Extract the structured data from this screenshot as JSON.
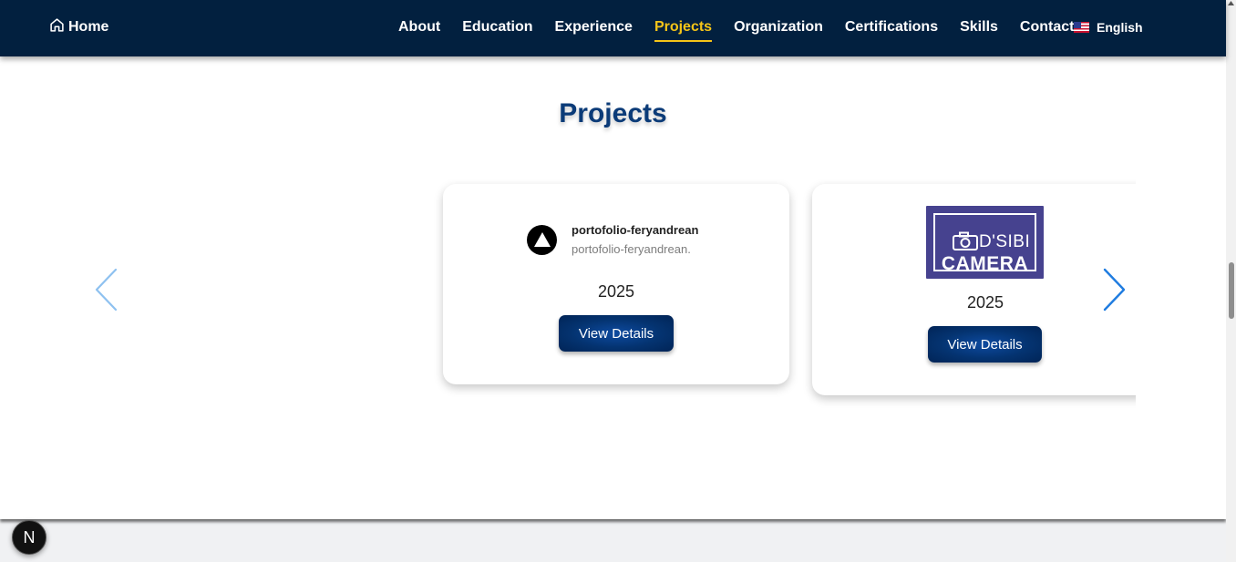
{
  "nav": {
    "home_label": "Home",
    "home_icon": "home-icon",
    "items": [
      {
        "label": "About"
      },
      {
        "label": "Education"
      },
      {
        "label": "Experience"
      },
      {
        "label": "Projects",
        "active": true
      },
      {
        "label": "Organization"
      },
      {
        "label": "Certifications"
      },
      {
        "label": "Skills"
      },
      {
        "label": "Contact"
      }
    ],
    "language": {
      "label": "English",
      "flag_icon": "us-flag-icon"
    },
    "colors": {
      "background": "#02203f",
      "active": "#f5c518",
      "text": "#ffffff"
    }
  },
  "section": {
    "title": "Projects",
    "title_color": "#0b3b78"
  },
  "projects": [
    {
      "logo_icon": "vercel-triangle-icon",
      "name": "portofolio-feryandrean",
      "url": "portofolio-feryandrean.",
      "year": "2025",
      "button_label": "View Details"
    },
    {
      "logo": {
        "line1": "D'SIBI",
        "line2": "CAMERA",
        "icon": "camera-icon",
        "background": "#46428f"
      },
      "year": "2025",
      "button_label": "View Details"
    }
  ],
  "carousel": {
    "prev_icon": "chevron-left-icon",
    "next_icon": "chevron-right-icon",
    "prev_color": "#8ec1f0",
    "next_color": "#1f7ce0"
  },
  "dev_badge": {
    "label": "N"
  }
}
